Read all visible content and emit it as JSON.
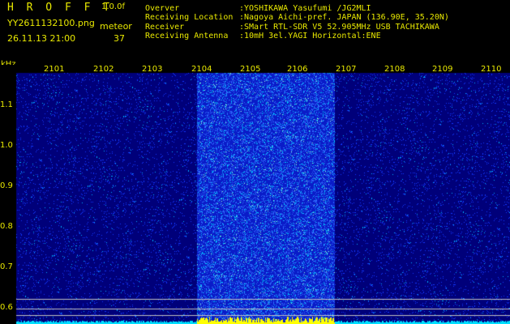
{
  "header": {
    "title": "H R O F F T",
    "version": "1.0.0f",
    "filename": "YY2611132100.png",
    "datetime": "26.11.13 21:00",
    "meteor_label": "meteor",
    "meteor_count": "37"
  },
  "meta": [
    {
      "key": "Overver",
      "value": ":YOSHIKAWA Yasufumi /JG2MLI"
    },
    {
      "key": "Receiving Location",
      "value": ":Nagoya Aichi-pref. JAPAN (136.90E, 35.20N)"
    },
    {
      "key": "Receiver",
      "value": ":SMart RTL-SDR V5 52.905MHz USB TACHIKAWA"
    },
    {
      "key": "Receiving Antenna",
      "value": ":10mH 3el.YAGI Horizontal:ENE"
    }
  ],
  "axis": {
    "unit": "kHz",
    "x_ticks": [
      "2101",
      "2102",
      "2103",
      "2104",
      "2105",
      "2106",
      "2107",
      "2108",
      "2109",
      "2110"
    ],
    "y_ticks": [
      "1.1",
      "1.0",
      "0.9",
      "0.8",
      "0.7",
      "0.6"
    ]
  },
  "colors": {
    "label": "#e8e800",
    "background_noise": "#00008a",
    "band_noise": "#1a40ff",
    "trace": "#00e0ff",
    "strip": "#ffff00"
  }
}
